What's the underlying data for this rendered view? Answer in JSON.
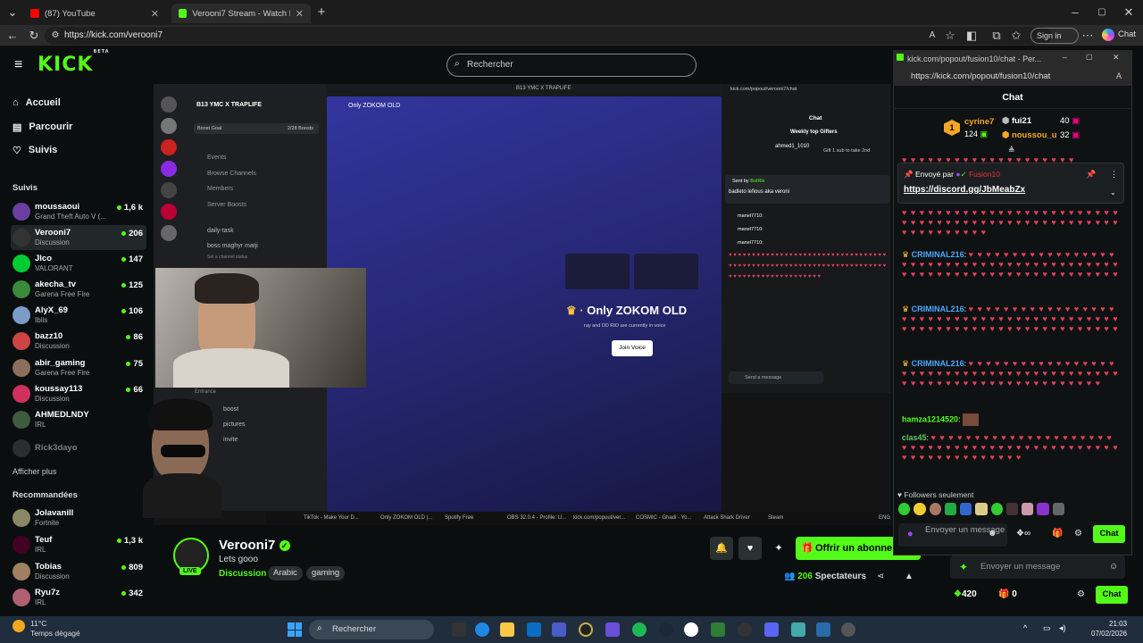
{
  "browser": {
    "tabs": [
      {
        "label": "(87) YouTube",
        "active": false
      },
      {
        "label": "Verooni7 Stream - Watch Live on K",
        "active": true
      }
    ],
    "url": "https://kick.com/verooni7",
    "signin": "Sign in",
    "chat_btn": "Chat"
  },
  "kick": {
    "logo": "KICK",
    "beta": "BETA",
    "search_placeholder": "Rechercher"
  },
  "sidebar": {
    "nav": [
      "Accueil",
      "Parcourir",
      "Suivis"
    ],
    "section_follow": "Suivis",
    "follows": [
      {
        "name": "moussaoui",
        "cat": "Grand Theft Auto V (...",
        "viewers": "1,6 k"
      },
      {
        "name": "Verooni7",
        "cat": "Discussion",
        "viewers": "206"
      },
      {
        "name": "Jlco",
        "cat": "VALORANT",
        "viewers": "147"
      },
      {
        "name": "akecha_tv",
        "cat": "Garena Free Fire",
        "viewers": "125"
      },
      {
        "name": "AlyX_69",
        "cat": "Iblis",
        "viewers": "106"
      },
      {
        "name": "bazz10",
        "cat": "Discussion",
        "viewers": "86"
      },
      {
        "name": "abir_gaming",
        "cat": "Garena Free Fire",
        "viewers": "75"
      },
      {
        "name": "koussay113",
        "cat": "Discussion",
        "viewers": "66"
      },
      {
        "name": "AHMEDLNDY",
        "cat": "IRL",
        "viewers": ""
      },
      {
        "name": "Rick3dayo",
        "cat": "",
        "viewers": ""
      }
    ],
    "show_more": "Afficher plus",
    "section_rec": "Recommandées",
    "recs": [
      {
        "name": "Jolavanill",
        "cat": "Fortnite",
        "viewers": ""
      },
      {
        "name": "Teuf",
        "cat": "IRL",
        "viewers": "1,3 k"
      },
      {
        "name": "Tobias",
        "cat": "Discussion",
        "viewers": "809"
      },
      {
        "name": "Ryu7z",
        "cat": "IRL",
        "viewers": "342"
      }
    ]
  },
  "video": {
    "server_name": "B13 YMC X TRAPLIFE",
    "channel_title": "Only ZOKOM OLD",
    "voice_title": "Only ZOKOM OLD",
    "voice_sub": "ray and DD RIO  are currently in voice",
    "join_voice": "Join Voice",
    "boost_goal": "Boost Goal",
    "boosts": "2/28 Boosts",
    "channels": [
      "Events",
      "Browse Channels",
      "Members",
      "Server Boosts"
    ],
    "dm_items": [
      "daily-task",
      "boss maghyr matji",
      "Set a channel status"
    ],
    "entrance": "Entrance",
    "lower_items": [
      "boost",
      "pictures",
      "invite"
    ],
    "inner_chat_url": "kick.com/popout/verooni7/chat",
    "inner_chat_title": "Chat",
    "inner_weekly": "Weekly top Gifters",
    "inner_gifter": "ahmed1_1010",
    "inner_gift_hint": "Gift 1 sub to take 2nd",
    "inner_sent_by": "Sent by",
    "inner_botrix": "BotRix",
    "inner_msg": "badleto lefious aka veroni",
    "inner_users": [
      "manel7710:",
      "manel7710:",
      "manel7710:"
    ],
    "inner_send": "Send a message",
    "taskbar_items": [
      "TikTok - Make Your D...",
      "Only ZOKOM OLD |...",
      "Spotify Free",
      "OBS 32.0.4 - Profile: U...",
      "kick.com/popout/ver...",
      "COSMIC - Ghadi - Yo...",
      "Attack Shark Driver",
      "Steam"
    ],
    "lang": "ENG"
  },
  "stream": {
    "name": "Verooni7",
    "title": "Lets gooo",
    "category": "Discussion",
    "tags": [
      "Arabic",
      "gaming"
    ],
    "live": "LIVE",
    "subscribe": "Offrir un abonne",
    "viewers_count": "206",
    "viewers_label": "Spectateurs"
  },
  "popout": {
    "title": "kick.com/popout/fusion10/chat - Per...",
    "url": "https://kick.com/popout/fusion10/chat",
    "chat_header": "Chat",
    "gifters": [
      {
        "rank": "1",
        "name": "cyrine7",
        "count": "124"
      },
      {
        "rank": "",
        "name": "fui21",
        "count": "40"
      },
      {
        "rank": "",
        "name": "noussou_u",
        "count": "32"
      }
    ],
    "pinned_prefix": "Envoyé par",
    "pinned_user": "Fusion10",
    "pinned_link": "https://discord.gg/JbMeabZx",
    "messages": [
      {
        "user": "CRIMINAL216",
        "text": ""
      },
      {
        "user": "CRIMINAL216",
        "text": ""
      },
      {
        "user": "CRIMINAL216",
        "text": ""
      },
      {
        "user": "hamza1214520",
        "text": ""
      },
      {
        "user": "clas45",
        "text": ""
      }
    ],
    "followers_only": "Followers seulement",
    "input_placeholder": "Envoyer un message",
    "chat_btn": "Chat"
  },
  "kickchat": {
    "input_placeholder": "Envoyer un message",
    "points": "420",
    "gifts": "0",
    "chat_btn": "Chat"
  },
  "taskbar": {
    "temp": "11°C",
    "weather": "Temps dégagé",
    "search": "Rechercher",
    "time": "21:03",
    "date": "07/02/2026"
  },
  "colors": {
    "kick_green": "#53fc18",
    "bg": "#0b0e0f"
  }
}
